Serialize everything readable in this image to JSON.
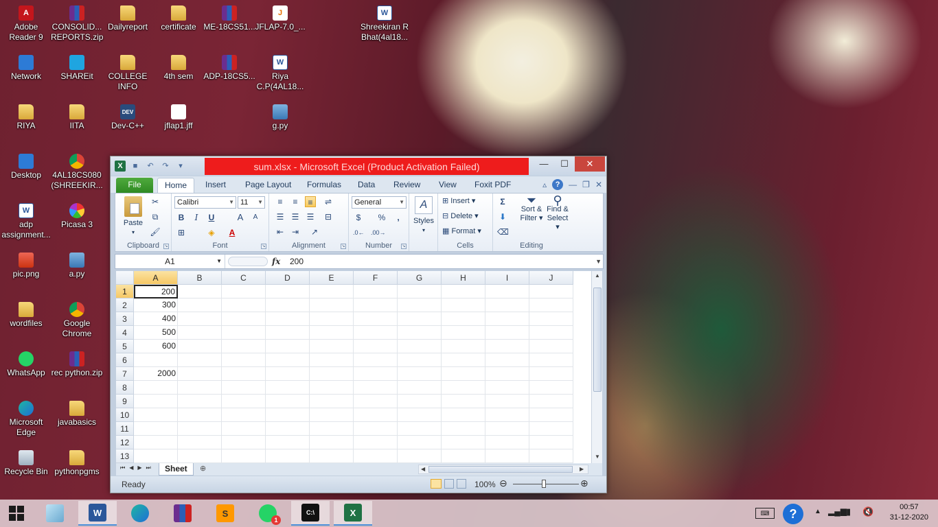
{
  "desktop_icons": [
    {
      "label": "Adobe Reader 9",
      "icon": "pdf-icon"
    },
    {
      "label": "CONSOLID... REPORTS.zip",
      "icon": "zip-icon"
    },
    {
      "label": "Dailyreport",
      "icon": "folder-icon"
    },
    {
      "label": "certificate",
      "icon": "folder-icon"
    },
    {
      "label": "ME-18CS51...",
      "icon": "zip-icon"
    },
    {
      "label": "JFLAP-7.0_...",
      "icon": "java-icon"
    },
    {
      "label": "Shreekiran R Bhat(4al18...",
      "icon": "word-doc-icon"
    },
    {
      "label": "Network",
      "icon": "network-icon"
    },
    {
      "label": "SHAREit",
      "icon": "shareit-icon"
    },
    {
      "label": "COLLEGE INFO",
      "icon": "folder-icon"
    },
    {
      "label": "4th sem",
      "icon": "folder-icon"
    },
    {
      "label": "ADP-18CS5...",
      "icon": "zip-icon"
    },
    {
      "label": "Riya C.P(4AL18...",
      "icon": "word-doc-icon"
    },
    {
      "label": "RIYA",
      "icon": "folder-icon"
    },
    {
      "label": "IITA",
      "icon": "folder-icon"
    },
    {
      "label": "Dev-C++",
      "icon": "devcpp-icon"
    },
    {
      "label": "jflap1.jff",
      "icon": "file-icon"
    },
    {
      "label": "g.py",
      "icon": "python-icon"
    },
    {
      "label": "Desktop",
      "icon": "desktop-icon"
    },
    {
      "label": "4AL18CS080 (SHREEKIR...",
      "icon": "chrome-icon"
    },
    {
      "label": "adp assignment...",
      "icon": "word-doc-icon"
    },
    {
      "label": "Picasa 3",
      "icon": "picasa-icon"
    },
    {
      "label": "pic.png",
      "icon": "image-icon"
    },
    {
      "label": "a.py",
      "icon": "python-icon"
    },
    {
      "label": "wordfiles",
      "icon": "folder-icon"
    },
    {
      "label": "Google Chrome",
      "icon": "chrome-icon"
    },
    {
      "label": "WhatsApp",
      "icon": "whatsapp-icon"
    },
    {
      "label": "rec python.zip",
      "icon": "zip-icon"
    },
    {
      "label": "Microsoft Edge",
      "icon": "edge-icon"
    },
    {
      "label": "javabasics",
      "icon": "folder-icon"
    },
    {
      "label": "Recycle Bin",
      "icon": "recycle-bin-icon"
    },
    {
      "label": "pythonpgms",
      "icon": "folder-icon"
    }
  ],
  "excel": {
    "title": "sum.xlsx - Microsoft Excel (Product Activation Failed)",
    "tabs": [
      "File",
      "Home",
      "Insert",
      "Page Layout",
      "Formulas",
      "Data",
      "Review",
      "View",
      "Foxit PDF"
    ],
    "active_tab": "Home",
    "ribbon": {
      "clipboard": {
        "label": "Clipboard",
        "paste": "Paste"
      },
      "font": {
        "label": "Font",
        "name": "Calibri",
        "size": "11",
        "bold": "B",
        "italic": "I",
        "underline": "U",
        "grow": "A",
        "shrink": "A"
      },
      "alignment": {
        "label": "Alignment"
      },
      "number": {
        "label": "Number",
        "format": "General",
        "percent": "%",
        "comma": ","
      },
      "styles": {
        "label": "Styles"
      },
      "cells": {
        "label": "Cells",
        "insert": "Insert",
        "delete": "Delete",
        "format": "Format"
      },
      "editing": {
        "label": "Editing",
        "sort": "Sort &",
        "sort2": "Filter",
        "find": "Find &",
        "find2": "Select",
        "sum": "Σ"
      }
    },
    "formula_bar": {
      "name_box": "A1",
      "fx": "fx",
      "value": "200"
    },
    "columns": [
      "A",
      "B",
      "C",
      "D",
      "E",
      "F",
      "G",
      "H",
      "I",
      "J"
    ],
    "rows": [
      "1",
      "2",
      "3",
      "4",
      "5",
      "6",
      "7",
      "8",
      "9",
      "10",
      "11",
      "12",
      "13"
    ],
    "cells": {
      "A1": "200",
      "A2": "300",
      "A3": "400",
      "A4": "500",
      "A5": "600",
      "A7": "2000"
    },
    "sheet_tab": "Sheet",
    "status": {
      "ready": "Ready",
      "zoom": "100%"
    }
  },
  "taskbar": {
    "time": "00:57",
    "date": "31-12-2020",
    "whatsapp_badge": "1"
  }
}
